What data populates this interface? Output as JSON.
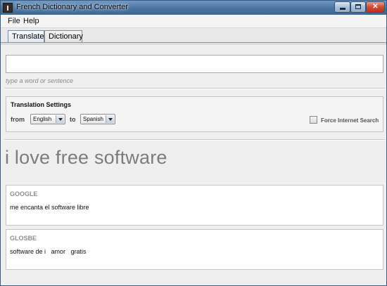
{
  "window": {
    "title": "French Dictionary and Converter"
  },
  "menu": {
    "items": [
      "File",
      "Help"
    ]
  },
  "tabs": [
    {
      "label": "Translate",
      "active": true
    },
    {
      "label": "Dictionary",
      "active": false
    }
  ],
  "input": {
    "value": "",
    "hint": "type a word or sentence"
  },
  "settings": {
    "title": "Translation Settings",
    "from_label": "from",
    "from_value": "English",
    "to_label": "to",
    "to_value": "Spanish",
    "force_label": "Force Internet Search",
    "force_checked": false
  },
  "query_display": "i love free software",
  "results": [
    {
      "source": "GOOGLE",
      "text": "me encanta el software libre"
    },
    {
      "source": "GLOSBE",
      "text": "software de i   amor   gratis"
    }
  ],
  "colors": {
    "title_bar": "#4a739f",
    "close_button": "#c0301c"
  }
}
